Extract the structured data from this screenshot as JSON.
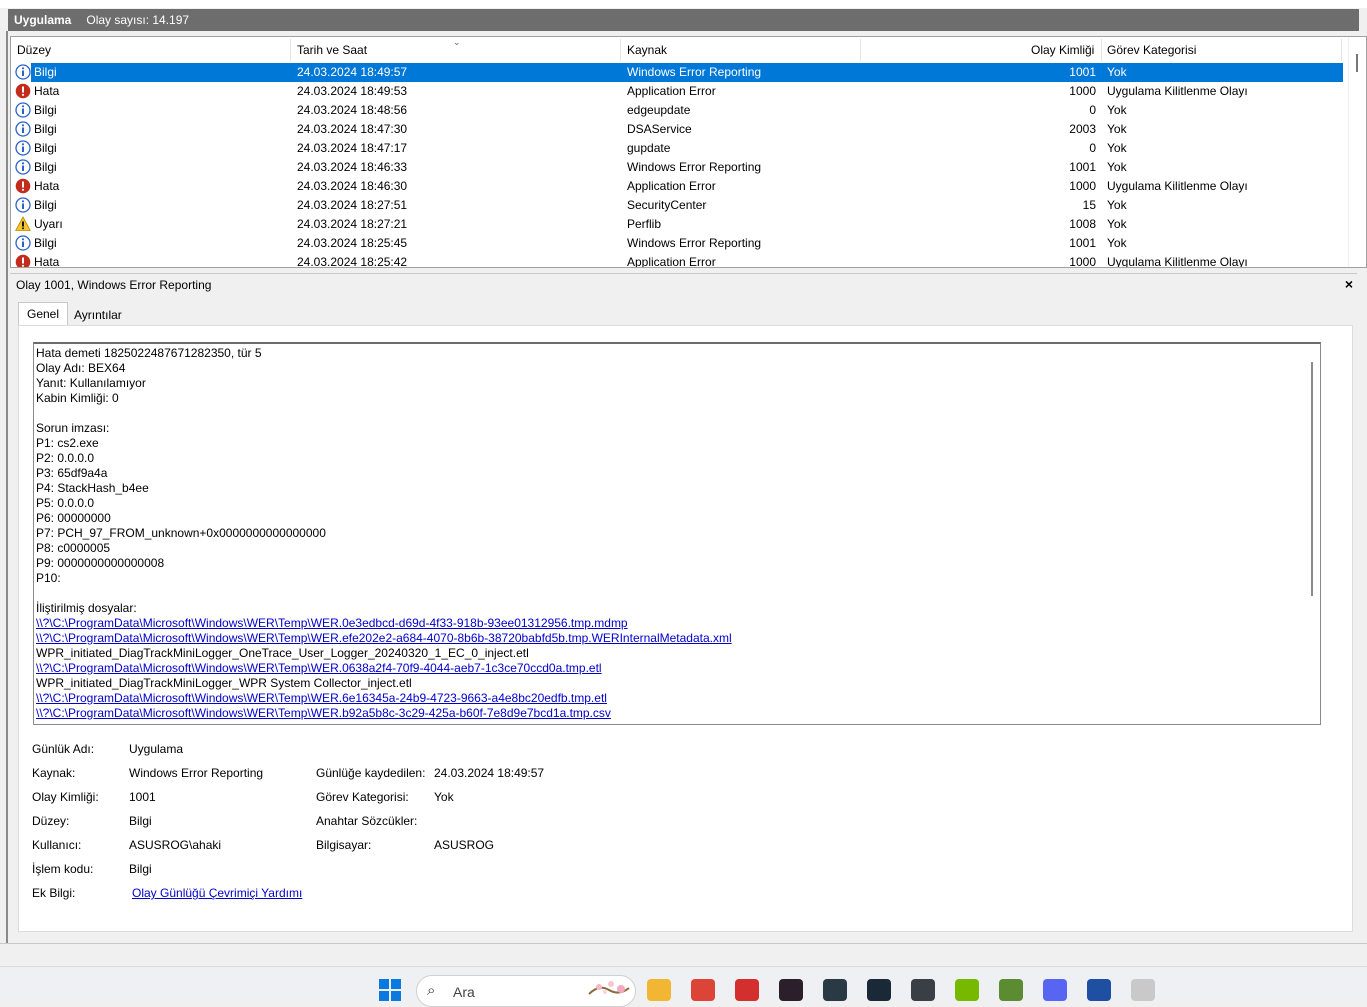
{
  "header": {
    "title": "Uygulama",
    "count_label": "Olay sayısı: 14.197"
  },
  "list": {
    "columns": [
      "Düzey",
      "Tarih ve Saat",
      "Kaynak",
      "Olay Kimliği",
      "Görev Kategorisi"
    ],
    "rows": [
      {
        "level": "Bilgi",
        "icon": "info-icon",
        "date": "24.03.2024 18:49:57",
        "source": "Windows Error Reporting",
        "id": "1001",
        "category": "Yok"
      },
      {
        "level": "Hata",
        "icon": "error-icon",
        "date": "24.03.2024 18:49:53",
        "source": "Application Error",
        "id": "1000",
        "category": "Uygulama Kilitlenme Olayı"
      },
      {
        "level": "Bilgi",
        "icon": "info-icon",
        "date": "24.03.2024 18:48:56",
        "source": "edgeupdate",
        "id": "0",
        "category": "Yok"
      },
      {
        "level": "Bilgi",
        "icon": "info-icon",
        "date": "24.03.2024 18:47:30",
        "source": "DSAService",
        "id": "2003",
        "category": "Yok"
      },
      {
        "level": "Bilgi",
        "icon": "info-icon",
        "date": "24.03.2024 18:47:17",
        "source": "gupdate",
        "id": "0",
        "category": "Yok"
      },
      {
        "level": "Bilgi",
        "icon": "info-icon",
        "date": "24.03.2024 18:46:33",
        "source": "Windows Error Reporting",
        "id": "1001",
        "category": "Yok"
      },
      {
        "level": "Hata",
        "icon": "error-icon",
        "date": "24.03.2024 18:46:30",
        "source": "Application Error",
        "id": "1000",
        "category": "Uygulama Kilitlenme Olayı"
      },
      {
        "level": "Bilgi",
        "icon": "info-icon",
        "date": "24.03.2024 18:27:51",
        "source": "SecurityCenter",
        "id": "15",
        "category": "Yok"
      },
      {
        "level": "Uyarı",
        "icon": "warning-icon",
        "date": "24.03.2024 18:27:21",
        "source": "Perflib",
        "id": "1008",
        "category": "Yok"
      },
      {
        "level": "Bilgi",
        "icon": "info-icon",
        "date": "24.03.2024 18:25:45",
        "source": "Windows Error Reporting",
        "id": "1001",
        "category": "Yok"
      },
      {
        "level": "Hata",
        "icon": "error-icon",
        "date": "24.03.2024 18:25:42",
        "source": "Application Error",
        "id": "1000",
        "category": "Uygulama Kilitlenme Olayı"
      }
    ]
  },
  "detail": {
    "title": "Olay 1001, Windows Error Reporting",
    "close_glyph": "×",
    "tabs": [
      "Genel",
      "Ayrıntılar"
    ],
    "description_lines": [
      {
        "text": "Hata demeti 1825022487671282350, tür 5",
        "link": false
      },
      {
        "text": "Olay Adı: BEX64",
        "link": false
      },
      {
        "text": "Yanıt: Kullanılamıyor",
        "link": false
      },
      {
        "text": "Kabin Kimliği: 0",
        "link": false
      },
      {
        "text": "",
        "link": false
      },
      {
        "text": "Sorun imzası:",
        "link": false
      },
      {
        "text": "P1: cs2.exe",
        "link": false
      },
      {
        "text": "P2: 0.0.0.0",
        "link": false
      },
      {
        "text": "P3: 65df9a4a",
        "link": false
      },
      {
        "text": "P4: StackHash_b4ee",
        "link": false
      },
      {
        "text": "P5: 0.0.0.0",
        "link": false
      },
      {
        "text": "P6: 00000000",
        "link": false
      },
      {
        "text": "P7: PCH_97_FROM_unknown+0x0000000000000000",
        "link": false
      },
      {
        "text": "P8: c0000005",
        "link": false
      },
      {
        "text": "P9: 0000000000000008",
        "link": false
      },
      {
        "text": "P10:",
        "link": false
      },
      {
        "text": "",
        "link": false
      },
      {
        "text": "İliştirilmiş dosyalar:",
        "link": false
      },
      {
        "text": "\\\\?\\C:\\ProgramData\\Microsoft\\Windows\\WER\\Temp\\WER.0e3edbcd-d69d-4f33-918b-93ee01312956.tmp.mdmp",
        "link": true
      },
      {
        "text": "\\\\?\\C:\\ProgramData\\Microsoft\\Windows\\WER\\Temp\\WER.efe202e2-a684-4070-8b6b-38720babfd5b.tmp.WERInternalMetadata.xml",
        "link": true
      },
      {
        "text": "WPR_initiated_DiagTrackMiniLogger_OneTrace_User_Logger_20240320_1_EC_0_inject.etl",
        "link": false
      },
      {
        "text": "\\\\?\\C:\\ProgramData\\Microsoft\\Windows\\WER\\Temp\\WER.0638a2f4-70f9-4044-aeb7-1c3ce70ccd0a.tmp.etl",
        "link": true
      },
      {
        "text": "WPR_initiated_DiagTrackMiniLogger_WPR System Collector_inject.etl",
        "link": false
      },
      {
        "text": "\\\\?\\C:\\ProgramData\\Microsoft\\Windows\\WER\\Temp\\WER.6e16345a-24b9-4723-9663-a4e8bc20edfb.tmp.etl",
        "link": true
      },
      {
        "text": "\\\\?\\C:\\ProgramData\\Microsoft\\Windows\\WER\\Temp\\WER.b92a5b8c-3c29-425a-b60f-7e8d9e7bcd1a.tmp.csv",
        "link": true
      }
    ],
    "fields": {
      "log_name_label": "Günlük Adı:",
      "log_name": "Uygulama",
      "source_label": "Kaynak:",
      "source": "Windows Error Reporting",
      "logged_label": "Günlüğe kaydedilen:",
      "logged": "24.03.2024 18:49:57",
      "event_id_label": "Olay Kimliği:",
      "event_id": "1001",
      "task_label": "Görev Kategorisi:",
      "task": "Yok",
      "level_label": "Düzey:",
      "level": "Bilgi",
      "keywords_label": "Anahtar Sözcükler:",
      "keywords": "",
      "user_label": "Kullanıcı:",
      "user": "ASUSROG\\ahaki",
      "computer_label": "Bilgisayar:",
      "computer": "ASUSROG",
      "opcode_label": "İşlem kodu:",
      "opcode": "Bilgi",
      "more_info_label": "Ek Bilgi:",
      "more_info_link": "Olay Günlüğü Çevrimiçi Yardımı"
    }
  },
  "taskbar": {
    "search_placeholder": "Ara",
    "apps": [
      {
        "name": "file-explorer-icon",
        "color": "#f2b632"
      },
      {
        "name": "chrome-icon",
        "color": "#db4437"
      },
      {
        "name": "app-red-icon",
        "color": "#d32f2f"
      },
      {
        "name": "valorant-icon",
        "color": "#2b1f2b"
      },
      {
        "name": "league-icon",
        "color": "#2a3a45"
      },
      {
        "name": "steam-icon",
        "color": "#1b2838"
      },
      {
        "name": "app-dark-icon",
        "color": "#3a3f45"
      },
      {
        "name": "nvidia-icon",
        "color": "#76b900"
      },
      {
        "name": "minecraft-icon",
        "color": "#5b8c32"
      },
      {
        "name": "discord-icon",
        "color": "#5865f2"
      },
      {
        "name": "app-blue-icon",
        "color": "#1e4fa3"
      },
      {
        "name": "event-viewer-icon",
        "color": "#c9c9c9"
      }
    ]
  }
}
